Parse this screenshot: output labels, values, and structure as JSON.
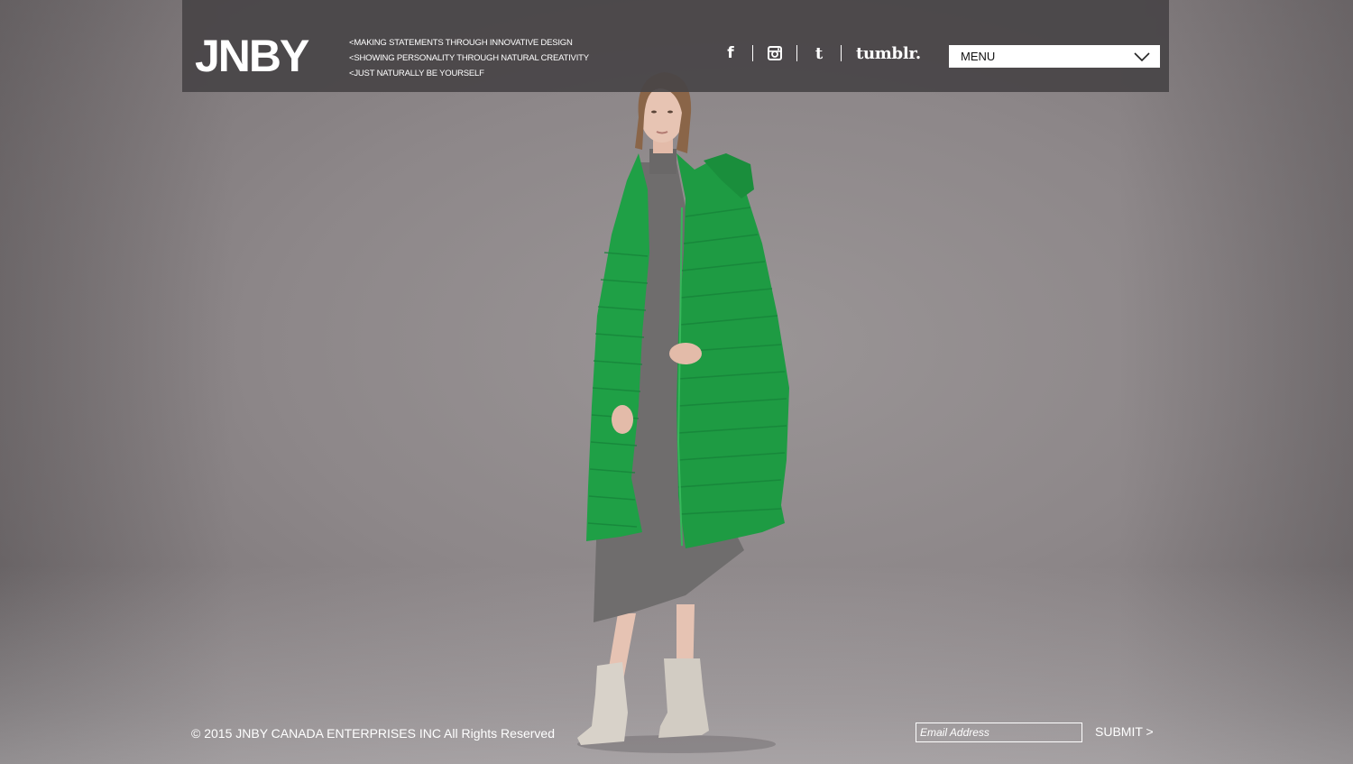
{
  "header": {
    "logo": "JNBY",
    "taglines": [
      "<MAKING STATEMENTS THROUGH INNOVATIVE DESIGN",
      "<SHOWING PERSONALITY THROUGH NATURAL CREATIVITY",
      "<JUST NATURALLY BE YOURSELF"
    ],
    "social": {
      "facebook": "f",
      "twitter": "t",
      "tumblr": "tumblr."
    },
    "menu": {
      "label": "MENU"
    }
  },
  "hero": {
    "coat_color": "#1fa046",
    "dress_color": "#6f6d6d",
    "boots_color": "#d6d0c8"
  },
  "footer": {
    "copyright": "© 2015 JNBY CANADA ENTERPRISES INC All Rights Reserved",
    "email_placeholder": "Email Address",
    "submit_label": "SUBMIT >"
  },
  "icons": [
    "facebook-icon",
    "instagram-icon",
    "twitter-icon",
    "tumblr-icon",
    "chevron-down-icon"
  ]
}
